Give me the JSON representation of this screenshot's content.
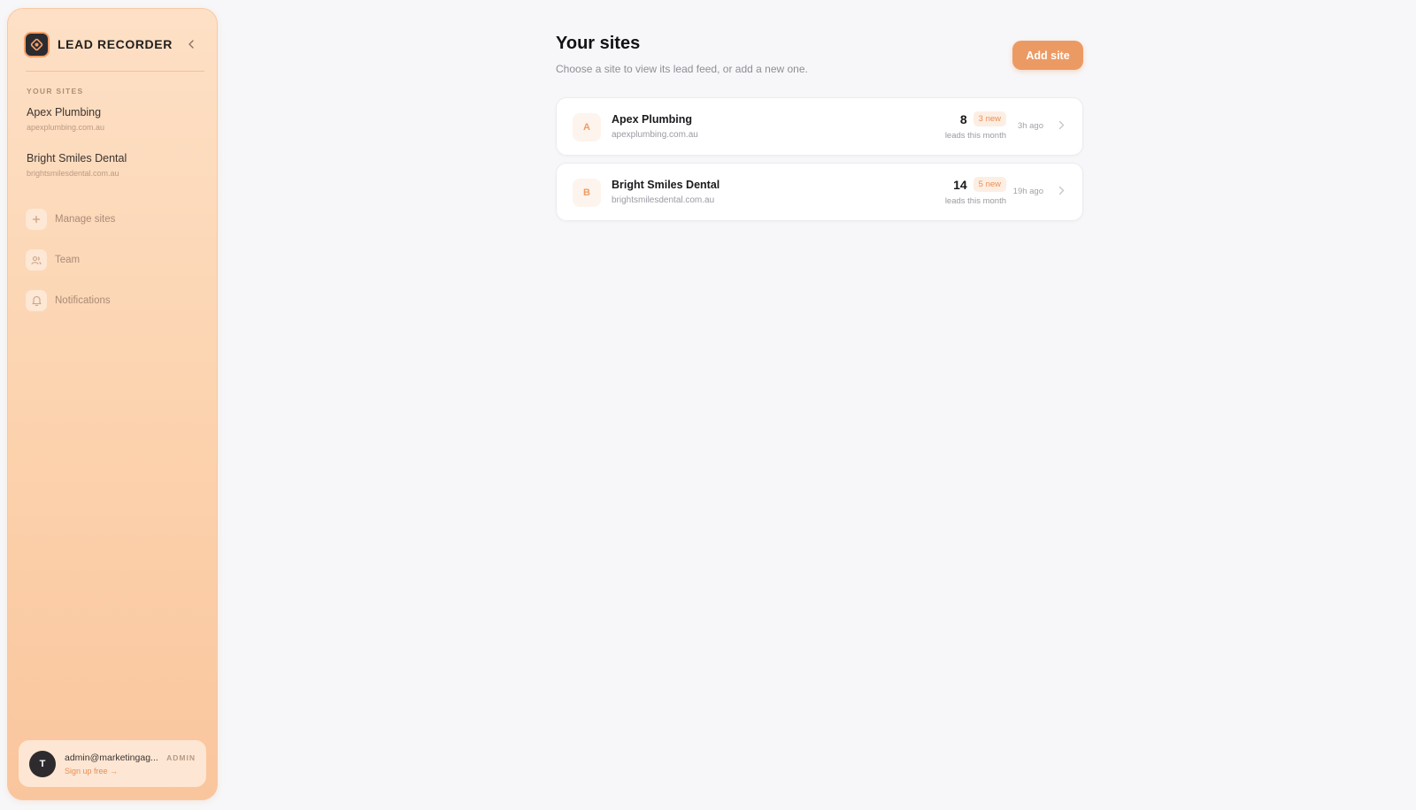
{
  "sidebar": {
    "brand_name": "LEAD RECORDER",
    "section_label": "YOUR SITES",
    "sites": [
      {
        "name": "Apex Plumbing",
        "domain": "apexplumbing.com.au"
      },
      {
        "name": "Bright Smiles Dental",
        "domain": "brightsmilesdental.com.au"
      }
    ],
    "nav": [
      {
        "label": "Manage sites",
        "icon": "plus-icon"
      },
      {
        "label": "Team",
        "icon": "users-icon"
      },
      {
        "label": "Notifications",
        "icon": "bell-icon"
      }
    ],
    "user": {
      "initial": "T",
      "email": "admin@marketingag...",
      "signup_link": "Sign up free →",
      "role": "ADMIN"
    }
  },
  "main": {
    "title": "Your sites",
    "subtitle": "Choose a site to view its lead feed, or add a new one.",
    "add_button": "Add site",
    "cards": [
      {
        "letter": "A",
        "name": "Apex Plumbing",
        "domain": "apexplumbing.com.au",
        "count": "8",
        "new_badge": "3 new",
        "count_label": "leads this month",
        "time": "3h ago"
      },
      {
        "letter": "B",
        "name": "Bright Smiles Dental",
        "domain": "brightsmilesdental.com.au",
        "count": "14",
        "new_badge": "5 new",
        "count_label": "leads this month",
        "time": "19h ago"
      }
    ]
  },
  "colors": {
    "accent": "#ec9a63",
    "sidebar_bg": "#fcd2ad",
    "page_bg": "#f7f7f9"
  }
}
